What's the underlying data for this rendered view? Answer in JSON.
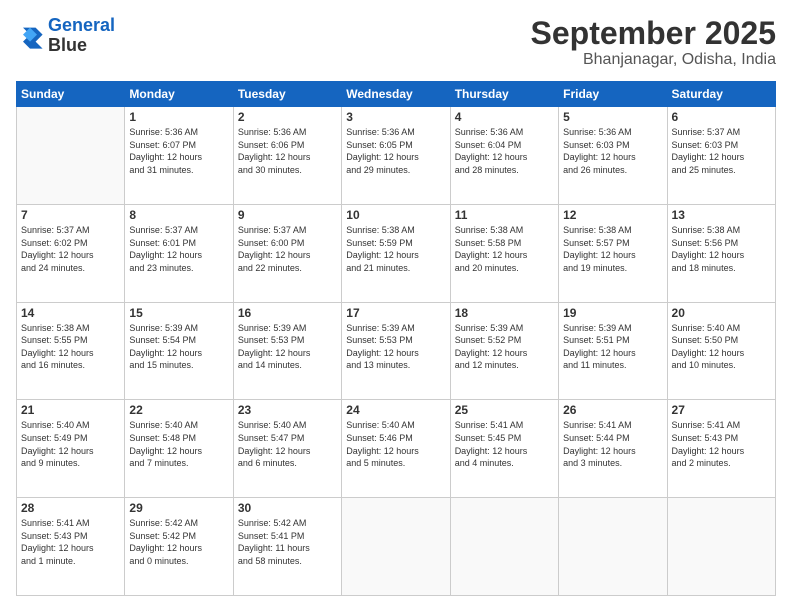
{
  "logo": {
    "line1": "General",
    "line2": "Blue"
  },
  "title": "September 2025",
  "location": "Bhanjanagar, Odisha, India",
  "days_of_week": [
    "Sunday",
    "Monday",
    "Tuesday",
    "Wednesday",
    "Thursday",
    "Friday",
    "Saturday"
  ],
  "weeks": [
    [
      {
        "day": "",
        "info": ""
      },
      {
        "day": "1",
        "info": "Sunrise: 5:36 AM\nSunset: 6:07 PM\nDaylight: 12 hours\nand 31 minutes."
      },
      {
        "day": "2",
        "info": "Sunrise: 5:36 AM\nSunset: 6:06 PM\nDaylight: 12 hours\nand 30 minutes."
      },
      {
        "day": "3",
        "info": "Sunrise: 5:36 AM\nSunset: 6:05 PM\nDaylight: 12 hours\nand 29 minutes."
      },
      {
        "day": "4",
        "info": "Sunrise: 5:36 AM\nSunset: 6:04 PM\nDaylight: 12 hours\nand 28 minutes."
      },
      {
        "day": "5",
        "info": "Sunrise: 5:36 AM\nSunset: 6:03 PM\nDaylight: 12 hours\nand 26 minutes."
      },
      {
        "day": "6",
        "info": "Sunrise: 5:37 AM\nSunset: 6:03 PM\nDaylight: 12 hours\nand 25 minutes."
      }
    ],
    [
      {
        "day": "7",
        "info": "Sunrise: 5:37 AM\nSunset: 6:02 PM\nDaylight: 12 hours\nand 24 minutes."
      },
      {
        "day": "8",
        "info": "Sunrise: 5:37 AM\nSunset: 6:01 PM\nDaylight: 12 hours\nand 23 minutes."
      },
      {
        "day": "9",
        "info": "Sunrise: 5:37 AM\nSunset: 6:00 PM\nDaylight: 12 hours\nand 22 minutes."
      },
      {
        "day": "10",
        "info": "Sunrise: 5:38 AM\nSunset: 5:59 PM\nDaylight: 12 hours\nand 21 minutes."
      },
      {
        "day": "11",
        "info": "Sunrise: 5:38 AM\nSunset: 5:58 PM\nDaylight: 12 hours\nand 20 minutes."
      },
      {
        "day": "12",
        "info": "Sunrise: 5:38 AM\nSunset: 5:57 PM\nDaylight: 12 hours\nand 19 minutes."
      },
      {
        "day": "13",
        "info": "Sunrise: 5:38 AM\nSunset: 5:56 PM\nDaylight: 12 hours\nand 18 minutes."
      }
    ],
    [
      {
        "day": "14",
        "info": "Sunrise: 5:38 AM\nSunset: 5:55 PM\nDaylight: 12 hours\nand 16 minutes."
      },
      {
        "day": "15",
        "info": "Sunrise: 5:39 AM\nSunset: 5:54 PM\nDaylight: 12 hours\nand 15 minutes."
      },
      {
        "day": "16",
        "info": "Sunrise: 5:39 AM\nSunset: 5:53 PM\nDaylight: 12 hours\nand 14 minutes."
      },
      {
        "day": "17",
        "info": "Sunrise: 5:39 AM\nSunset: 5:53 PM\nDaylight: 12 hours\nand 13 minutes."
      },
      {
        "day": "18",
        "info": "Sunrise: 5:39 AM\nSunset: 5:52 PM\nDaylight: 12 hours\nand 12 minutes."
      },
      {
        "day": "19",
        "info": "Sunrise: 5:39 AM\nSunset: 5:51 PM\nDaylight: 12 hours\nand 11 minutes."
      },
      {
        "day": "20",
        "info": "Sunrise: 5:40 AM\nSunset: 5:50 PM\nDaylight: 12 hours\nand 10 minutes."
      }
    ],
    [
      {
        "day": "21",
        "info": "Sunrise: 5:40 AM\nSunset: 5:49 PM\nDaylight: 12 hours\nand 9 minutes."
      },
      {
        "day": "22",
        "info": "Sunrise: 5:40 AM\nSunset: 5:48 PM\nDaylight: 12 hours\nand 7 minutes."
      },
      {
        "day": "23",
        "info": "Sunrise: 5:40 AM\nSunset: 5:47 PM\nDaylight: 12 hours\nand 6 minutes."
      },
      {
        "day": "24",
        "info": "Sunrise: 5:40 AM\nSunset: 5:46 PM\nDaylight: 12 hours\nand 5 minutes."
      },
      {
        "day": "25",
        "info": "Sunrise: 5:41 AM\nSunset: 5:45 PM\nDaylight: 12 hours\nand 4 minutes."
      },
      {
        "day": "26",
        "info": "Sunrise: 5:41 AM\nSunset: 5:44 PM\nDaylight: 12 hours\nand 3 minutes."
      },
      {
        "day": "27",
        "info": "Sunrise: 5:41 AM\nSunset: 5:43 PM\nDaylight: 12 hours\nand 2 minutes."
      }
    ],
    [
      {
        "day": "28",
        "info": "Sunrise: 5:41 AM\nSunset: 5:43 PM\nDaylight: 12 hours\nand 1 minute."
      },
      {
        "day": "29",
        "info": "Sunrise: 5:42 AM\nSunset: 5:42 PM\nDaylight: 12 hours\nand 0 minutes."
      },
      {
        "day": "30",
        "info": "Sunrise: 5:42 AM\nSunset: 5:41 PM\nDaylight: 11 hours\nand 58 minutes."
      },
      {
        "day": "",
        "info": ""
      },
      {
        "day": "",
        "info": ""
      },
      {
        "day": "",
        "info": ""
      },
      {
        "day": "",
        "info": ""
      }
    ]
  ]
}
